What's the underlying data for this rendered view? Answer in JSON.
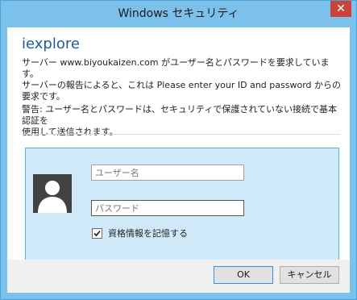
{
  "window": {
    "title": "Windows セキュリティ",
    "close_label": "✕"
  },
  "content": {
    "app_name": "iexplore",
    "message_line1": "サーバー www.biyoukaizen.com がユーザー名とパスワードを要求しています。",
    "message_line2": "サーバーの報告によると、これは Please enter your ID and password からの",
    "message_line3": "要求です。",
    "warning_line1": "警告: ユーザー名とパスワードは、セキュリティで保護されていない接続で基本認証を",
    "warning_line2": "使用して送信されます。"
  },
  "credentials": {
    "username_placeholder": "ユーザー名",
    "username_value": "",
    "password_placeholder": "パスワード",
    "password_value": "",
    "remember_label": "資格情報を記憶する",
    "remember_checked": true,
    "avatar_icon": "user-avatar-icon"
  },
  "footer": {
    "ok_label": "OK",
    "cancel_label": "キャンセル"
  },
  "colors": {
    "titlebar": "#7cc0ec",
    "accent_text": "#1c5d99",
    "panel_bg": "#cfe9f8",
    "panel_border": "#5ab1e2",
    "close_button": "#c7443c"
  }
}
